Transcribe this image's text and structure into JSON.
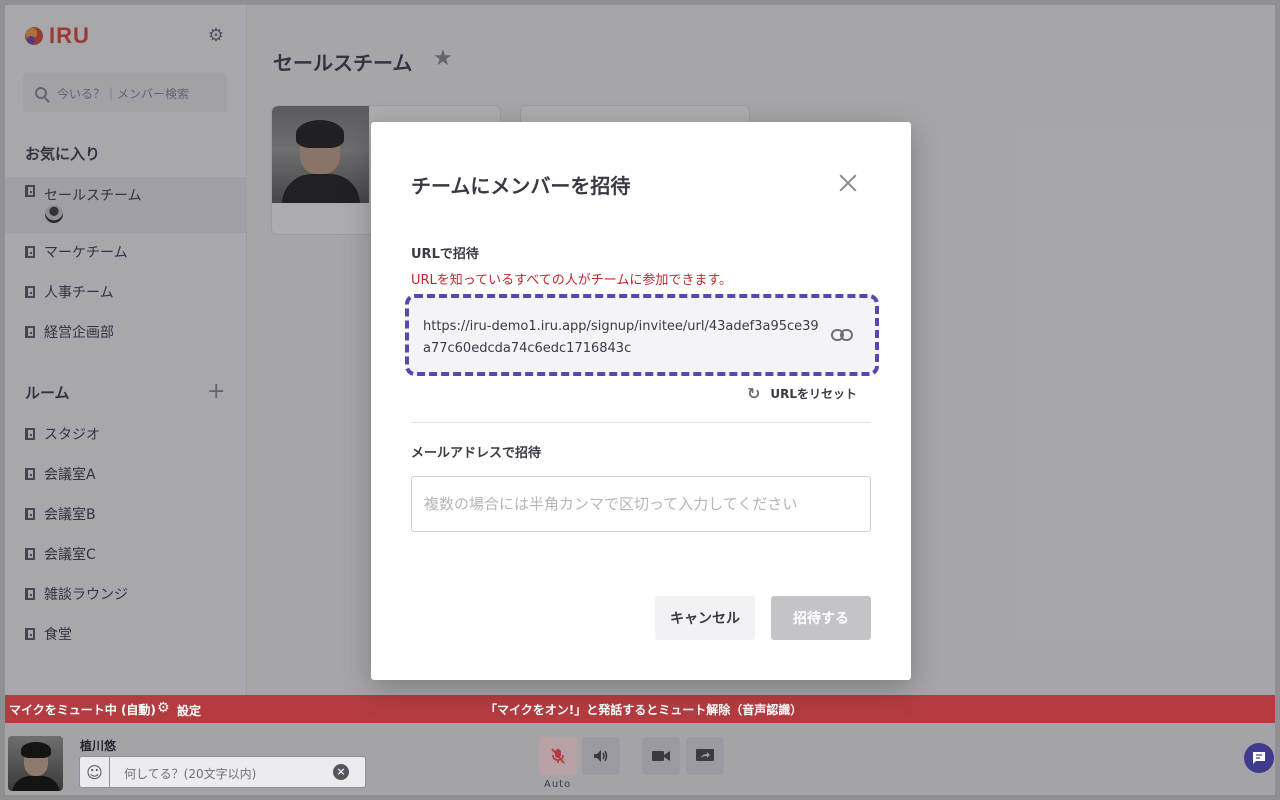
{
  "app": {
    "logo_text": "IRU"
  },
  "sidebar": {
    "search_placeholder": "今いる？｜メンバー検索",
    "favorites_title": "お気に入り",
    "favorites": [
      {
        "label": "セールスチーム"
      },
      {
        "label": "マーケチーム"
      },
      {
        "label": "人事チーム"
      },
      {
        "label": "経営企画部"
      }
    ],
    "rooms_title": "ルーム",
    "rooms": [
      {
        "label": "スタジオ"
      },
      {
        "label": "会議室A"
      },
      {
        "label": "会議室B"
      },
      {
        "label": "会議室C"
      },
      {
        "label": "雑談ラウンジ"
      },
      {
        "label": "食堂"
      }
    ]
  },
  "main": {
    "title": "セールスチーム"
  },
  "mute_bar": {
    "status": "マイクをミュート中 (自動)",
    "settings_label": "設定",
    "hint": "「マイクをオン!」と発話するとミュート解除（音声認識）",
    "color": "#b43c40"
  },
  "footer": {
    "user_name": "植川悠",
    "status_placeholder": "何してる？(20文字以内)",
    "mic_mode": "Auto"
  },
  "modal": {
    "title": "チームにメンバーを招待",
    "url_label": "URLで招待",
    "url_warning": "URLを知っているすべての人がチームに参加できます。",
    "invite_url": "https://iru-demo1.iru.app/signup/invitee/url/43adef3a95ce39a77c60edcda74c6edc1716843c",
    "reset_label": "URLをリセット",
    "email_label": "メールアドレスで招待",
    "email_placeholder": "複数の場合には半角カンマで区切って入力してください",
    "email_value": "",
    "cancel_label": "キャンセル",
    "invite_label": "招待する",
    "highlight_color": "#5a46b0",
    "warning_color": "#c0282e"
  }
}
